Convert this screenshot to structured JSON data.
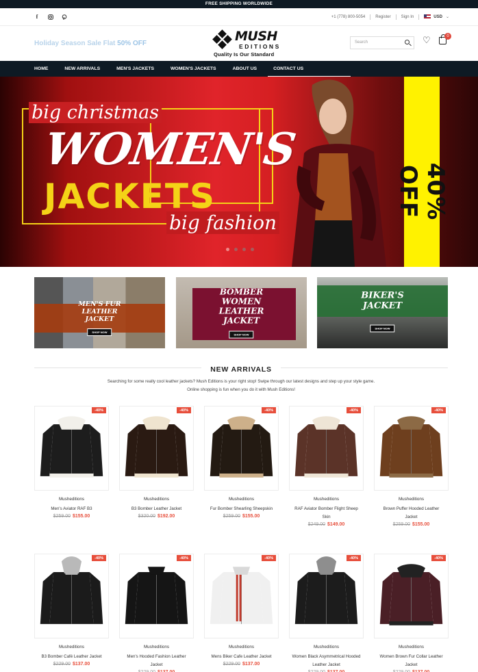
{
  "topbar": {
    "text": "FREE SHIPPING WORLDWIDE"
  },
  "social": {
    "icons": [
      "facebook-icon",
      "instagram-icon",
      "pinterest-icon"
    ]
  },
  "utility": {
    "phone": "+1 (778) 800-5054",
    "register": "Register",
    "signin": "Sign In",
    "currency": "USD"
  },
  "header": {
    "promo_text": "Holiday Season Sale Flat",
    "promo_percent": "50% OFF",
    "logo_main": "MUSH",
    "logo_sub": "EDITIONS",
    "logo_tagline": "Quality Is Our Standard",
    "search_placeholder": "Search",
    "cart_count": "0"
  },
  "nav": {
    "items": [
      "HOME",
      "NEW ARRIVALS",
      "MEN'S JACKETS",
      "WOMEN'S JACKETS",
      "ABOUT US",
      "CONTACT US"
    ]
  },
  "hero": {
    "line1": "big christmas",
    "line2": "WOMEN'S",
    "line3": "JACKETS",
    "line4": "big fashion",
    "discount": "40% OFF"
  },
  "banners": [
    {
      "title_line1": "MEN'S FUR",
      "title_line2": "LEATHER JACKET",
      "button": "SHOP NOW"
    },
    {
      "title_line1": "BOMBER WOMEN",
      "title_line2": "LEATHER JACKET",
      "button": "SHOP NOW"
    },
    {
      "title_line1": "BIKER'S JACKET",
      "title_line2": "",
      "button": "SHOP NOW"
    }
  ],
  "section": {
    "title": "NEW ARRIVALS",
    "description": "Searching for some really cool leather jackets? Mush Editions is your right stop! Swipe through our latest designs and step up your style game. Online shopping is fun when you do it with Mush Editions!"
  },
  "colors": {
    "dark": "#0e1a24",
    "accent": "#e74e3b"
  },
  "products": [
    {
      "badge": "-40%",
      "vendor": "Musheditions",
      "title": "Men's Aviator RAF B3",
      "old_price": "$259.00",
      "price": "$155.00"
    },
    {
      "badge": "-40%",
      "vendor": "Musheditions",
      "title": "B3 Bomber Leather Jacket",
      "old_price": "$320.00",
      "price": "$192.00"
    },
    {
      "badge": "-40%",
      "vendor": "Musheditions",
      "title": "Fur Bomber Shearling Sheepskin",
      "old_price": "$259.00",
      "price": "$155.00"
    },
    {
      "badge": "-40%",
      "vendor": "Musheditions",
      "title": "RAF Aviator Bomber Flight Sheep Skin",
      "old_price": "$249.00",
      "price": "$149.00"
    },
    {
      "badge": "-40%",
      "vendor": "Musheditions",
      "title": "Brown Puffer Hooded Leather Jacket",
      "old_price": "$259.00",
      "price": "$155.00"
    },
    {
      "badge": "-40%",
      "vendor": "Musheditions",
      "title": "B3 Bomber Café Leather Jacket",
      "old_price": "$229.00",
      "price": "$137.00"
    },
    {
      "badge": "-40%",
      "vendor": "Musheditions",
      "title": "Men's Hooded Fashion Leather Jacket",
      "old_price": "$229.00",
      "price": "$137.00"
    },
    {
      "badge": "-40%",
      "vendor": "Musheditions",
      "title": "Mens Biker Cafe Leather Jacket",
      "old_price": "$229.00",
      "price": "$137.00"
    },
    {
      "badge": "-40%",
      "vendor": "Musheditions",
      "title": "Women Black Asymmetrical Hooded Leather Jacket",
      "old_price": "$229.00",
      "price": "$137.00"
    },
    {
      "badge": "-40%",
      "vendor": "Musheditions",
      "title": "Women Brown Fur Collar Leather Jacket",
      "old_price": "$229.00",
      "price": "$137.00"
    }
  ]
}
